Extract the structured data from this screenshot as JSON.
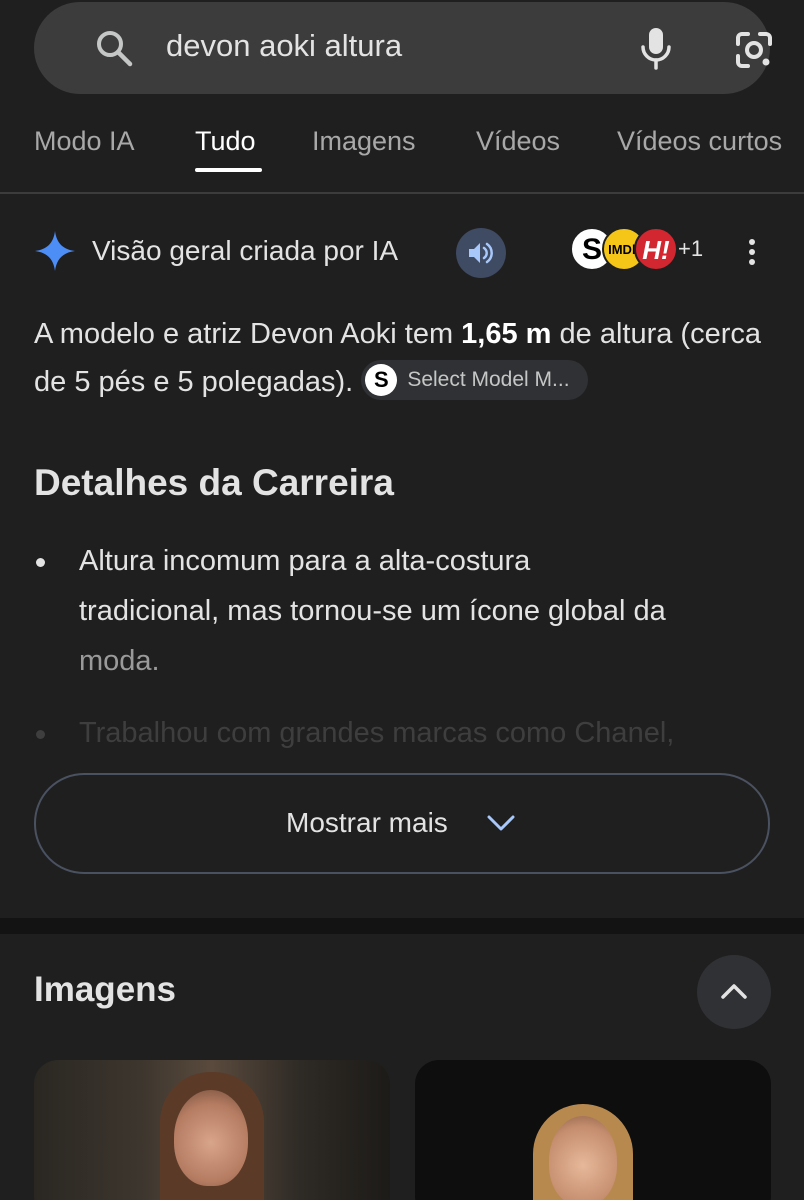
{
  "search": {
    "query": "devon aoki altura",
    "icons": [
      "search-icon",
      "mic-icon",
      "lens-icon"
    ]
  },
  "tabs": [
    {
      "label": "Modo IA",
      "active": false
    },
    {
      "label": "Tudo",
      "active": true
    },
    {
      "label": "Imagens",
      "active": false
    },
    {
      "label": "Vídeos",
      "active": false
    },
    {
      "label": "Vídeos curtos",
      "active": false
    }
  ],
  "ai_overview": {
    "title": "Visão geral criada por IA",
    "sources": {
      "logos": [
        "S",
        "IMDb",
        "H!"
      ],
      "extra_count": "+1"
    },
    "answer": {
      "part1": "A modelo e atriz Devon Aoki tem ",
      "bold": "1,65 m",
      "part2": " de altura (cerca de 5 pés e 5 polegadas).",
      "chip_logo": "S",
      "chip_label": "Select Model M..."
    },
    "section_title": "Detalhes da Carreira",
    "bullets": [
      {
        "line1": "Altura incomum para a alta-costura",
        "line2": "tradicional, mas tornou-se um ícone global da",
        "line3": "moda."
      },
      {
        "text": "Trabalhou com grandes marcas como Chanel,"
      }
    ],
    "show_more_label": "Mostrar mais"
  },
  "images_section": {
    "title": "Imagens"
  },
  "colors": {
    "background": "#1f1f1f",
    "search_bar": "#3c3c3c",
    "accent_blue": "#4c8df6",
    "speaker_button": "#3f4a63"
  }
}
